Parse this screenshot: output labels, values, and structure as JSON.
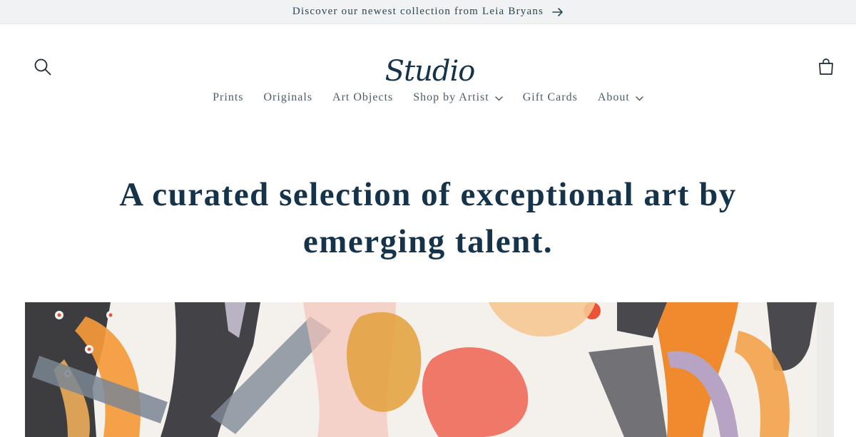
{
  "announcement": {
    "text": "Discover our newest collection from Leia Bryans",
    "icon": "arrow-right-icon"
  },
  "header": {
    "logo_text": "Studio",
    "search_icon": "search-icon",
    "cart_icon": "cart-icon"
  },
  "nav": {
    "items": [
      {
        "label": "Prints",
        "has_dropdown": false
      },
      {
        "label": "Originals",
        "has_dropdown": false
      },
      {
        "label": "Art Objects",
        "has_dropdown": false
      },
      {
        "label": "Shop by Artist",
        "has_dropdown": true
      },
      {
        "label": "Gift Cards",
        "has_dropdown": false
      },
      {
        "label": "About",
        "has_dropdown": true
      }
    ]
  },
  "hero": {
    "line1": "A curated selection of exceptional art by",
    "line2": "emerging talent."
  },
  "colors": {
    "primary_text": "#15334a",
    "nav_text": "#4c5c66",
    "announcement_bg": "#f1f2f3",
    "orange": "#f08a2e",
    "coral": "#ef5a4c",
    "charcoal": "#3b3b3d",
    "grey_blue": "#6f7e8c",
    "lavender": "#b9a6c4",
    "pink": "#f2a79a"
  }
}
